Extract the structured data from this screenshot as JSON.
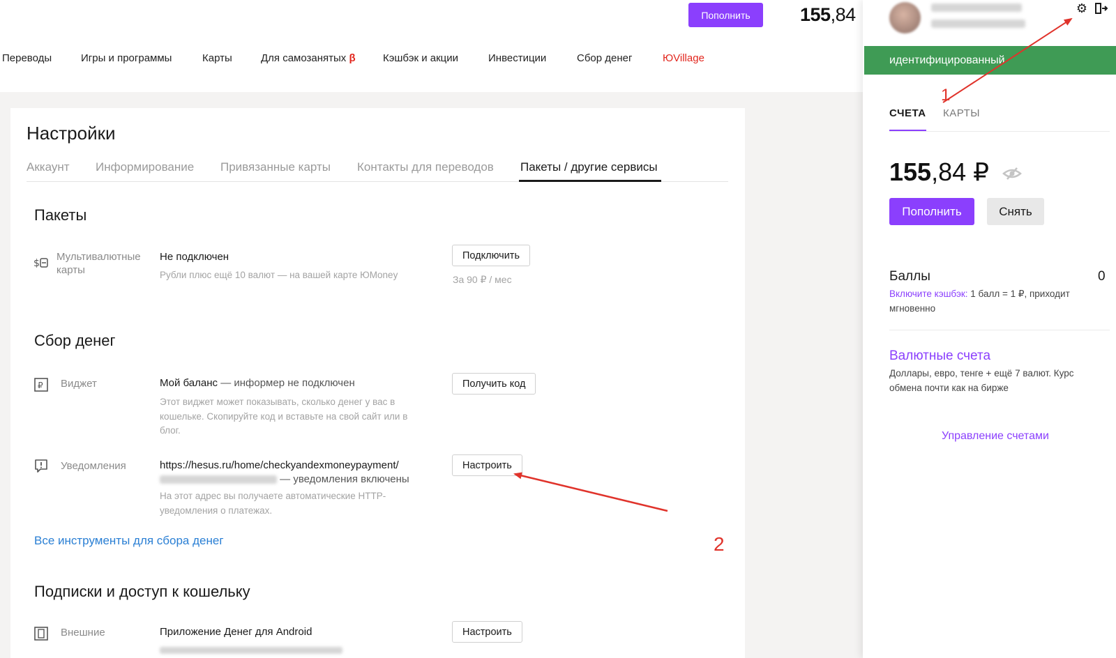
{
  "header": {
    "topup_label": "Пополнить",
    "balance_int": "155",
    "balance_frac": ",84",
    "nav": [
      {
        "label": "Переводы"
      },
      {
        "label": "Игры и программы"
      },
      {
        "label": "Карты"
      },
      {
        "label": "Для самозанятых",
        "badge": "β"
      },
      {
        "label": "Кэшбэк и акции"
      },
      {
        "label": "Инвестиции"
      },
      {
        "label": "Сбор денег"
      },
      {
        "label": "ЮVillage"
      }
    ]
  },
  "settings": {
    "title": "Настройки",
    "tabs": [
      {
        "label": "Аккаунт"
      },
      {
        "label": "Информирование"
      },
      {
        "label": "Привязанные карты"
      },
      {
        "label": "Контакты для переводов"
      },
      {
        "label": "Пакеты / другие сервисы"
      }
    ],
    "packages": {
      "heading": "Пакеты",
      "multicurrency": {
        "label": "Мультивалютные карты",
        "status": "Не подключен",
        "desc": "Рубли плюс ещё 10 валют — на вашей карте ЮMoney",
        "button": "Подключить",
        "price": "За 90 ₽ / мес"
      }
    },
    "fundraising": {
      "heading": "Сбор денег",
      "widget": {
        "label": "Виджет",
        "title": "Мой баланс",
        "status": "— информер не подключен",
        "desc": "Этот виджет может показывать, сколько денег у вас в кошельке. Скопируйте код и вставьте на свой сайт или в блог.",
        "button": "Получить код"
      },
      "notifications": {
        "label": "Уведомления",
        "url": "https://hesus.ru/home/checkyandexmoneypayment/",
        "status": "— уведомления включены",
        "desc": "На этот адрес вы получаете автоматические HTTP-уведомления о платежах.",
        "button": "Настроить"
      },
      "all_tools_link": "Все инструменты для сбора денег"
    },
    "subscriptions": {
      "heading": "Подписки и доступ к кошельку",
      "external": {
        "label": "Внешние",
        "app": "Приложение Денег для Android",
        "button": "Настроить"
      }
    }
  },
  "annotations": {
    "one": "1",
    "two": "2"
  },
  "panel": {
    "status": "идентифицированный",
    "tabs": {
      "accounts": "СЧЕТА",
      "cards": "КАРТЫ"
    },
    "balance_int": "155",
    "balance_frac": ",84 ₽",
    "topup": "Пополнить",
    "withdraw": "Снять",
    "points": {
      "title": "Баллы",
      "value": "0",
      "link": "Включите кэшбэк:",
      "desc": " 1 балл = 1 ₽, приходит мгновенно"
    },
    "fx": {
      "title": "Валютные счета",
      "desc": "Доллары, евро, тенге + ещё 7 валют. Курс обмена почти как на бирже"
    },
    "manage": "Управление счетами"
  },
  "colors": {
    "accent": "#8b3ffd",
    "status_green": "#3f9b55",
    "link_blue": "#2a7fd4",
    "annotation_red": "#e0332b"
  }
}
